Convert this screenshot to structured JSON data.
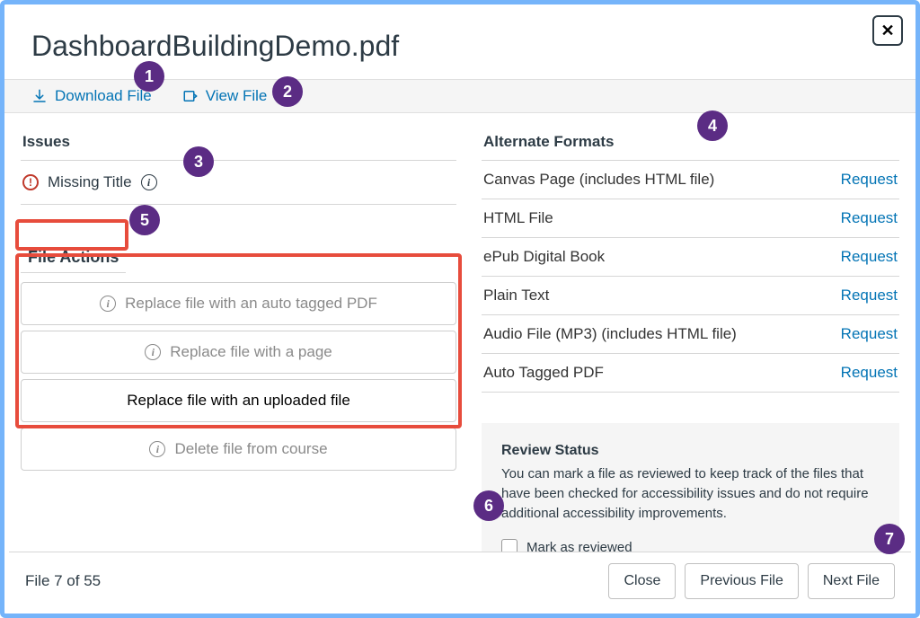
{
  "header": {
    "title": "DashboardBuildingDemo.pdf"
  },
  "toolbar": {
    "download_label": "Download File",
    "view_label": "View File"
  },
  "issues": {
    "heading": "Issues",
    "items": [
      {
        "label": "Missing Title"
      }
    ]
  },
  "file_actions": {
    "heading": "File Actions",
    "auto_tag": "Replace file with an auto tagged PDF",
    "with_page": "Replace file with a page",
    "upload": "Replace file with an uploaded file",
    "delete": "Delete file from course"
  },
  "alternate_formats": {
    "heading": "Alternate Formats",
    "request_label": "Request",
    "items": [
      "Canvas Page (includes HTML file)",
      "HTML File",
      "ePub Digital Book",
      "Plain Text",
      "Audio File (MP3) (includes HTML file)",
      "Auto Tagged PDF"
    ]
  },
  "review": {
    "heading": "Review Status",
    "text": "You can mark a file as reviewed to keep track of the files that have been checked for accessibility issues and do not require additional accessibility improvements.",
    "checkbox_label": "Mark as reviewed"
  },
  "footer": {
    "count_label": "File 7 of 55",
    "close": "Close",
    "prev": "Previous File",
    "next": "Next File"
  },
  "callouts": {
    "1": "1",
    "2": "2",
    "3": "3",
    "4": "4",
    "5": "5",
    "6": "6",
    "7": "7"
  }
}
